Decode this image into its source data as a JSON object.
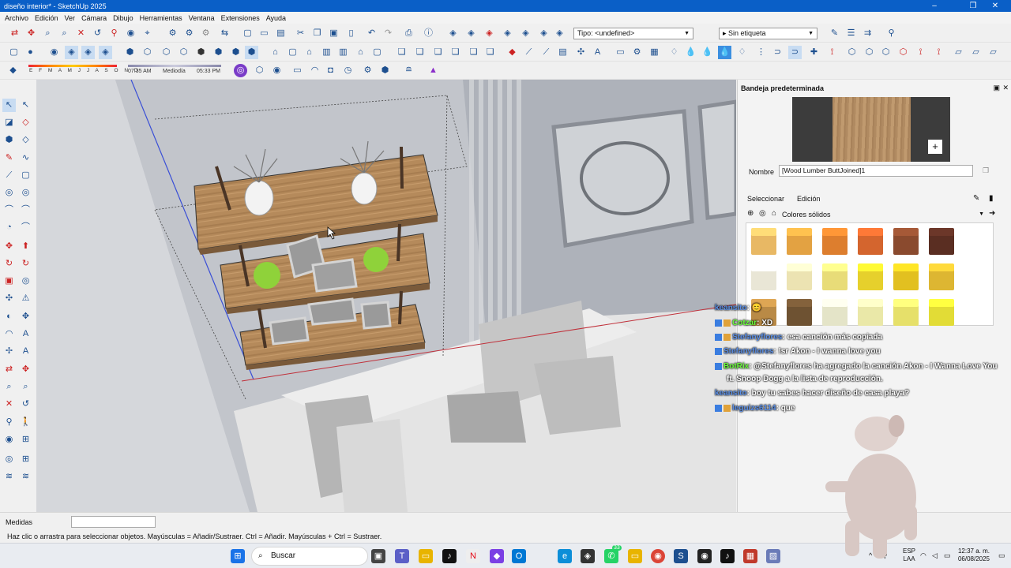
{
  "window": {
    "title": "diseño interior* - SketchUp 2025"
  },
  "menu": [
    "Archivo",
    "Edición",
    "Ver",
    "Cámara",
    "Dibujo",
    "Herramientas",
    "Ventana",
    "Extensiones",
    "Ayuda"
  ],
  "toolbar": {
    "type_select": "Tipo: <undefined>",
    "tag_select": "Sin etiqueta"
  },
  "shadow": {
    "months": "E F M A M J J A S O N D",
    "time_start": "07:35 AM",
    "mid": "Mediodía",
    "time_end": "05:33 PM"
  },
  "tray_panel": {
    "title": "Bandeja predeterminada",
    "name_label": "Nombre",
    "name_value": "[Wood Lumber ButtJoined]1",
    "tab_select": "Seleccionar",
    "tab_edit": "Edición",
    "collection": "Colores sólidos",
    "swatches": [
      "#e8b864",
      "#e3a242",
      "#dd7e2e",
      "#d4652e",
      "#8a4a2e",
      "#5a2e22",
      "#e9e6d6",
      "#ece3b2",
      "#e8dc78",
      "#e6d02c",
      "#e2c020",
      "#ddb632",
      "#b98a46",
      "#6e5232",
      "#e4e4c8",
      "#eae8a8",
      "#e6e06a",
      "#e2dc36"
    ]
  },
  "chat": [
    {
      "user": "keansito",
      "text": ": 😊"
    },
    {
      "user": "Cotzar",
      "text": ": XD"
    },
    {
      "user": "Stefanyflores",
      "text": ": esa canción más copiada"
    },
    {
      "user": "Stefanyflores",
      "text": ": !sr Akon - I wanna love you"
    },
    {
      "user": "BotRix",
      "text": ": @Stefanyflores ha agregado la canción Akon - I Wanna Love You"
    },
    {
      "user": "",
      "text": "ft. Snoop Dogg a la lista de reproducción."
    },
    {
      "user": "keansito",
      "text": ": boy tu sabes hacer diseño de casa playa?"
    },
    {
      "user": "leguizs6114",
      "text": ": que"
    }
  ],
  "status": {
    "measures_label": "Medidas",
    "hint": "Haz clic o arrastra para seleccionar objetos. Mayúsculas = Añadir/Sustraer. Ctrl = Añadir. Mayúsculas + Ctrl = Sustraer."
  },
  "taskbar": {
    "search": "Buscar",
    "lang1": "ESP",
    "lang2": "LAA",
    "time": "12:37 a. m.",
    "date": "06/08/2025",
    "whatsapp_badge": "33"
  }
}
